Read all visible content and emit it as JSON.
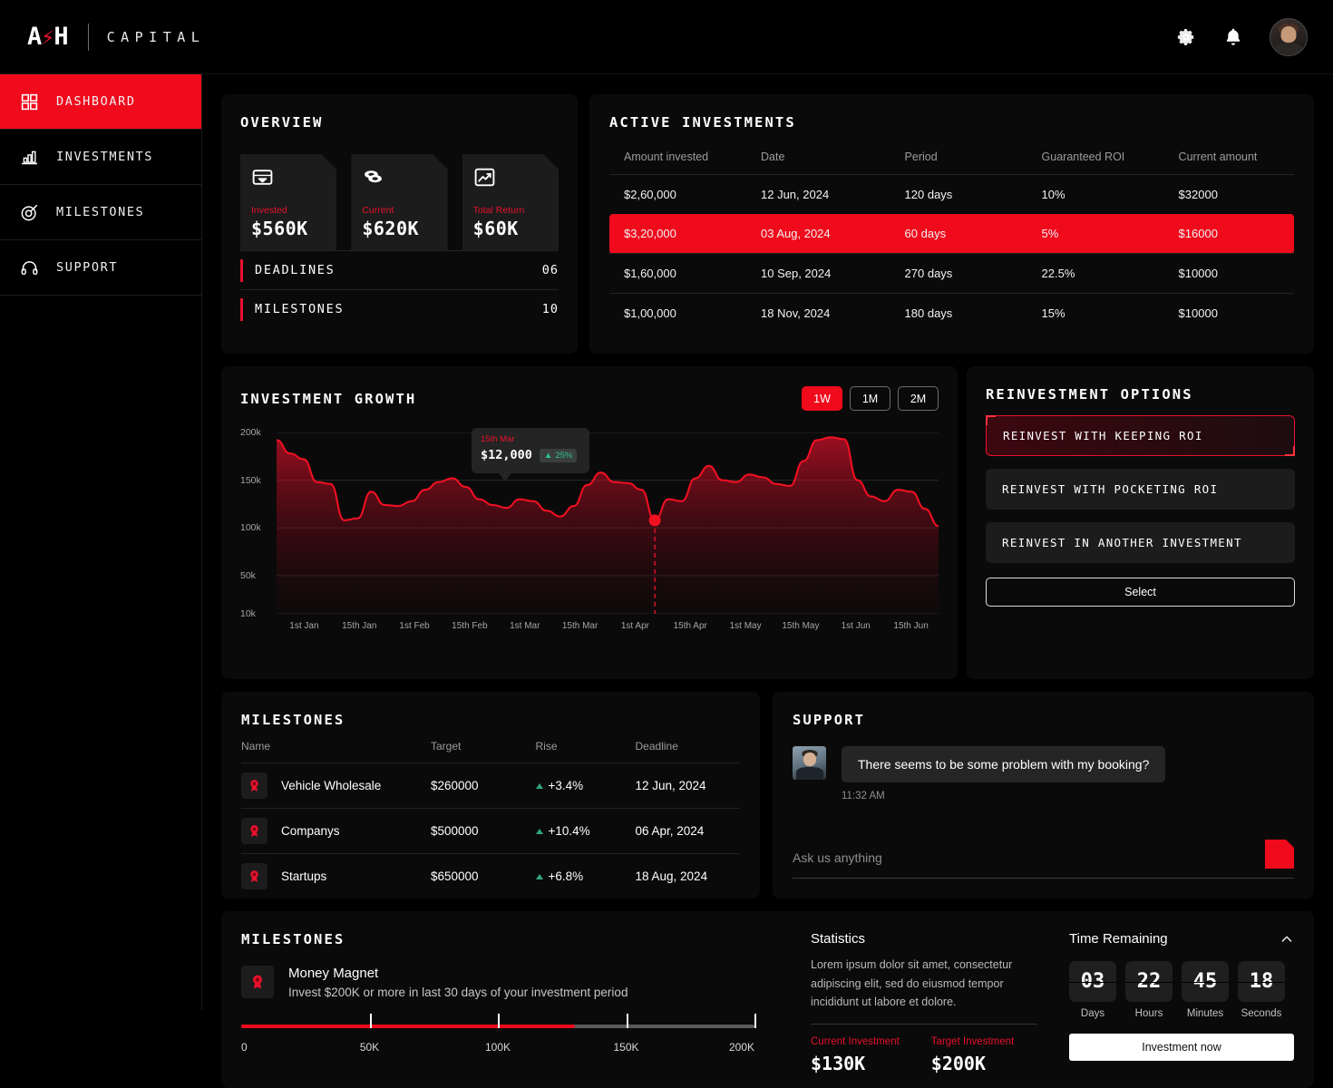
{
  "header": {
    "logo_main": "A",
    "logo_bolt": "⚡",
    "logo_main2": "H",
    "logo_sub": "CAPITAL",
    "settings_icon": "gear-icon",
    "notifications_icon": "bell-icon",
    "avatar": "user-avatar"
  },
  "sidebar": {
    "items": [
      {
        "label": "DASHBOARD",
        "icon": "grid-icon",
        "active": true
      },
      {
        "label": "INVESTMENTS",
        "icon": "bar-chart-icon",
        "active": false
      },
      {
        "label": "MILESTONES",
        "icon": "target-icon",
        "active": false
      },
      {
        "label": "SUPPORT",
        "icon": "headset-icon",
        "active": false
      }
    ]
  },
  "overview": {
    "title": "OVERVIEW",
    "cards": [
      {
        "label": "Invested",
        "value": "$560K",
        "icon": "wallet-icon"
      },
      {
        "label": "Current",
        "value": "$620K",
        "icon": "coins-icon"
      },
      {
        "label": "Total Return",
        "value": "$60K",
        "icon": "trend-up-icon"
      }
    ],
    "stats": [
      {
        "name": "DEADLINES",
        "count": "06"
      },
      {
        "name": "MILESTONES",
        "count": "10"
      }
    ]
  },
  "active_investments": {
    "title": "ACTIVE INVESTMENTS",
    "columns": [
      "Amount invested",
      "Date",
      "Period",
      "Guaranteed ROI",
      "Current amount"
    ],
    "rows": [
      {
        "amount": "$2,60,000",
        "date": "12 Jun, 2024",
        "period": "120 days",
        "roi": "10%",
        "current": "$32000",
        "highlight": false
      },
      {
        "amount": "$3,20,000",
        "date": "03 Aug, 2024",
        "period": "60 days",
        "roi": "5%",
        "current": "$16000",
        "highlight": true
      },
      {
        "amount": "$1,60,000",
        "date": "10 Sep, 2024",
        "period": "270 days",
        "roi": "22.5%",
        "current": "$10000",
        "highlight": false
      },
      {
        "amount": "$1,00,000",
        "date": "18 Nov, 2024",
        "period": "180 days",
        "roi": "15%",
        "current": "$10000",
        "highlight": false
      }
    ]
  },
  "chart_panel": {
    "title": "INVESTMENT GROWTH",
    "ranges": [
      {
        "label": "1W",
        "active": true
      },
      {
        "label": "1M",
        "active": false
      },
      {
        "label": "2M",
        "active": false
      }
    ],
    "tooltip": {
      "date": "15th Mar",
      "value": "$12,000",
      "change": "25%",
      "arrow": "▲"
    }
  },
  "chart_data": {
    "type": "area",
    "title": "INVESTMENT GROWTH",
    "xlabel": "",
    "ylabel": "",
    "ylim": [
      10000,
      200000
    ],
    "grid": true,
    "legend": "none",
    "ytick_labels": [
      "200k",
      "150k",
      "100k",
      "50k",
      "10k"
    ],
    "ytick_values": [
      200000,
      150000,
      100000,
      50000,
      10000
    ],
    "x": [
      "1st Jan",
      "15th Jan",
      "1st Feb",
      "15th Feb",
      "1st Mar",
      "15th Mar",
      "1st Apr",
      "15th Apr",
      "1st May",
      "15th May",
      "1st Jun",
      "15th Jun"
    ],
    "values": [
      192000,
      178000,
      172000,
      148000,
      146000,
      108000,
      110000,
      138000,
      124000,
      123000,
      128000,
      140000,
      148000,
      152000,
      143000,
      130000,
      124000,
      121000,
      130000,
      128000,
      118000,
      112000,
      123000,
      145000,
      158000,
      148000,
      147000,
      140000,
      108000,
      130000,
      128000,
      152000,
      165000,
      150000,
      148000,
      156000,
      153000,
      146000,
      144000,
      170000,
      192000,
      195000,
      193000,
      150000,
      133000,
      128000,
      140000,
      138000,
      120000,
      102000
    ],
    "highlight_point": {
      "x": "15th Mar",
      "y": 112000,
      "label": "$12,000",
      "change_pct": 25
    }
  },
  "reinvestment": {
    "title": "REINVESTMENT OPTIONS",
    "options": [
      {
        "label": "REINVEST WITH KEEPING ROI",
        "selected": true
      },
      {
        "label": "REINVEST WITH POCKETING ROI",
        "selected": false
      },
      {
        "label": "REINVEST IN ANOTHER INVESTMENT",
        "selected": false
      }
    ],
    "select_label": "Select"
  },
  "milestones_table": {
    "title": "MILESTONES",
    "columns": [
      "Name",
      "Target",
      "Rise",
      "Deadline"
    ],
    "rows": [
      {
        "name": "Vehicle Wholesale",
        "target": "$260000",
        "rise": "+3.4%",
        "deadline": "12 Jun, 2024",
        "icon": "award-icon"
      },
      {
        "name": "Companys",
        "target": "$500000",
        "rise": "+10.4%",
        "deadline": "06 Apr, 2024",
        "icon": "award-icon"
      },
      {
        "name": "Startups",
        "target": "$650000",
        "rise": "+6.8%",
        "deadline": "18 Aug, 2024",
        "icon": "award-icon"
      }
    ]
  },
  "support": {
    "title": "SUPPORT",
    "message": "There seems to be some problem with my booking?",
    "time": "11:32 AM",
    "input_placeholder": "Ask us anything",
    "input_value": "",
    "send_icon": "send-button"
  },
  "bottom": {
    "title": "MILESTONES",
    "milestone": {
      "name": "Money Magnet",
      "description": "Invest $200K or more in last 30 days of your investment period",
      "icon": "award-icon"
    },
    "progress": {
      "percent": 65,
      "ticks": [
        "0",
        "50K",
        "100K",
        "150K",
        "200K"
      ],
      "tick_positions": [
        0,
        25,
        50,
        75,
        100
      ]
    },
    "statistics": {
      "title": "Statistics",
      "body": "Lorem ipsum dolor sit amet, consectetur adipiscing elit, sed do eiusmod tempor incididunt ut labore et dolore.",
      "current_label": "Current Investment",
      "current_value": "$130K",
      "target_label": "Target Investment",
      "target_value": "$200K"
    },
    "timer": {
      "title": "Time Remaining",
      "collapse_icon": "chevron-up-icon",
      "units": [
        {
          "value": "03",
          "label": "Days"
        },
        {
          "value": "22",
          "label": "Hours"
        },
        {
          "value": "45",
          "label": "Minutes"
        },
        {
          "value": "18",
          "label": "Seconds"
        }
      ],
      "cta_label": "Investment now"
    }
  },
  "colors": {
    "accent": "#ef0a1c",
    "accent_dark": "#e8112d",
    "panel": "#0a0a0a",
    "card": "#1c1c1c",
    "positive": "#2fa87a"
  }
}
